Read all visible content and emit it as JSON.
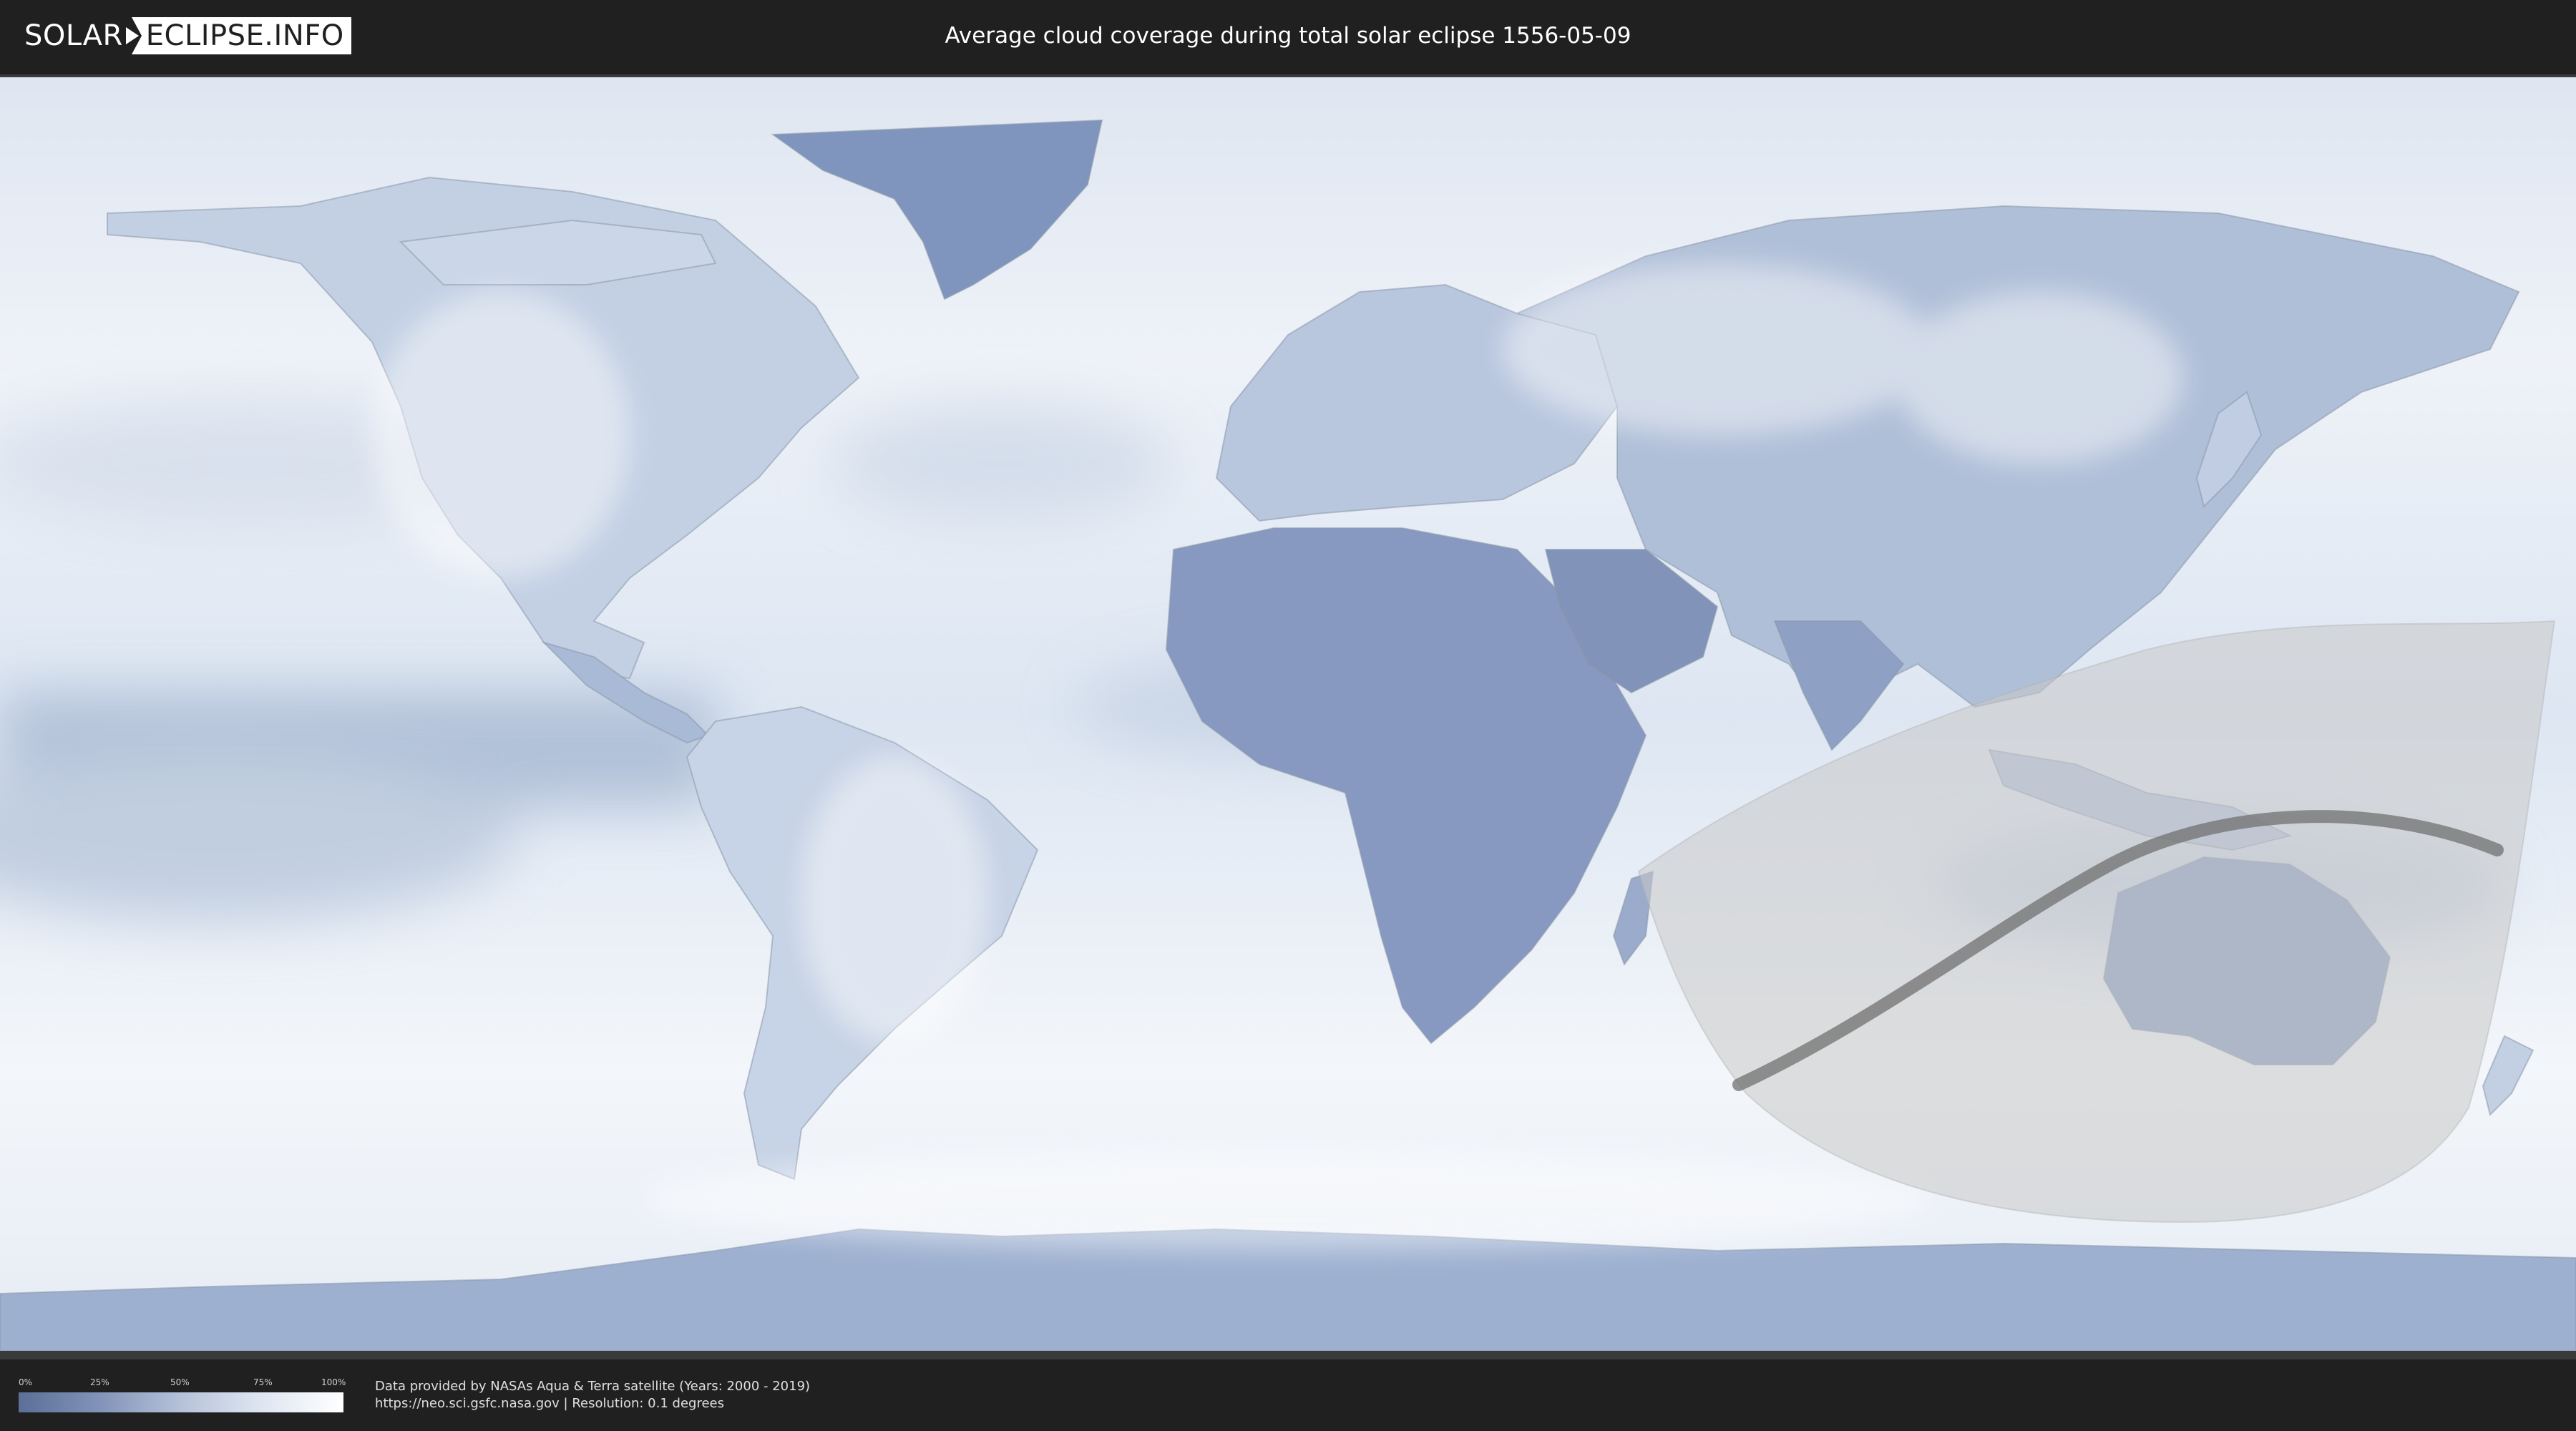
{
  "header": {
    "logo_left": "SOLAR",
    "logo_right": "ECLIPSE.INFO",
    "title": "Average cloud coverage during total solar eclipse 1556-05-09"
  },
  "map": {
    "ocean_color": "#e9eef6",
    "land_color": "#c3d0e4",
    "dry_color": "#7f95bd",
    "ice_color": "#b8c6de",
    "border_color": "#8a97aa",
    "path_shadow_color": "#d0d0d0",
    "central_line_color": "#707070"
  },
  "legend": {
    "ticks": [
      "0%",
      "25%",
      "50%",
      "75%",
      "100%"
    ],
    "gradient_colors": [
      "#5b6f97",
      "#8193b8",
      "#b6c2d9",
      "#dfe6f1",
      "#ffffff"
    ]
  },
  "footer": {
    "credit_line": "Data provided by NASAs Aqua & Terra satellite (Years: 2000 - 2019)",
    "source_line": "https://neo.sci.gsfc.nasa.gov | Resolution: 0.1 degrees"
  }
}
